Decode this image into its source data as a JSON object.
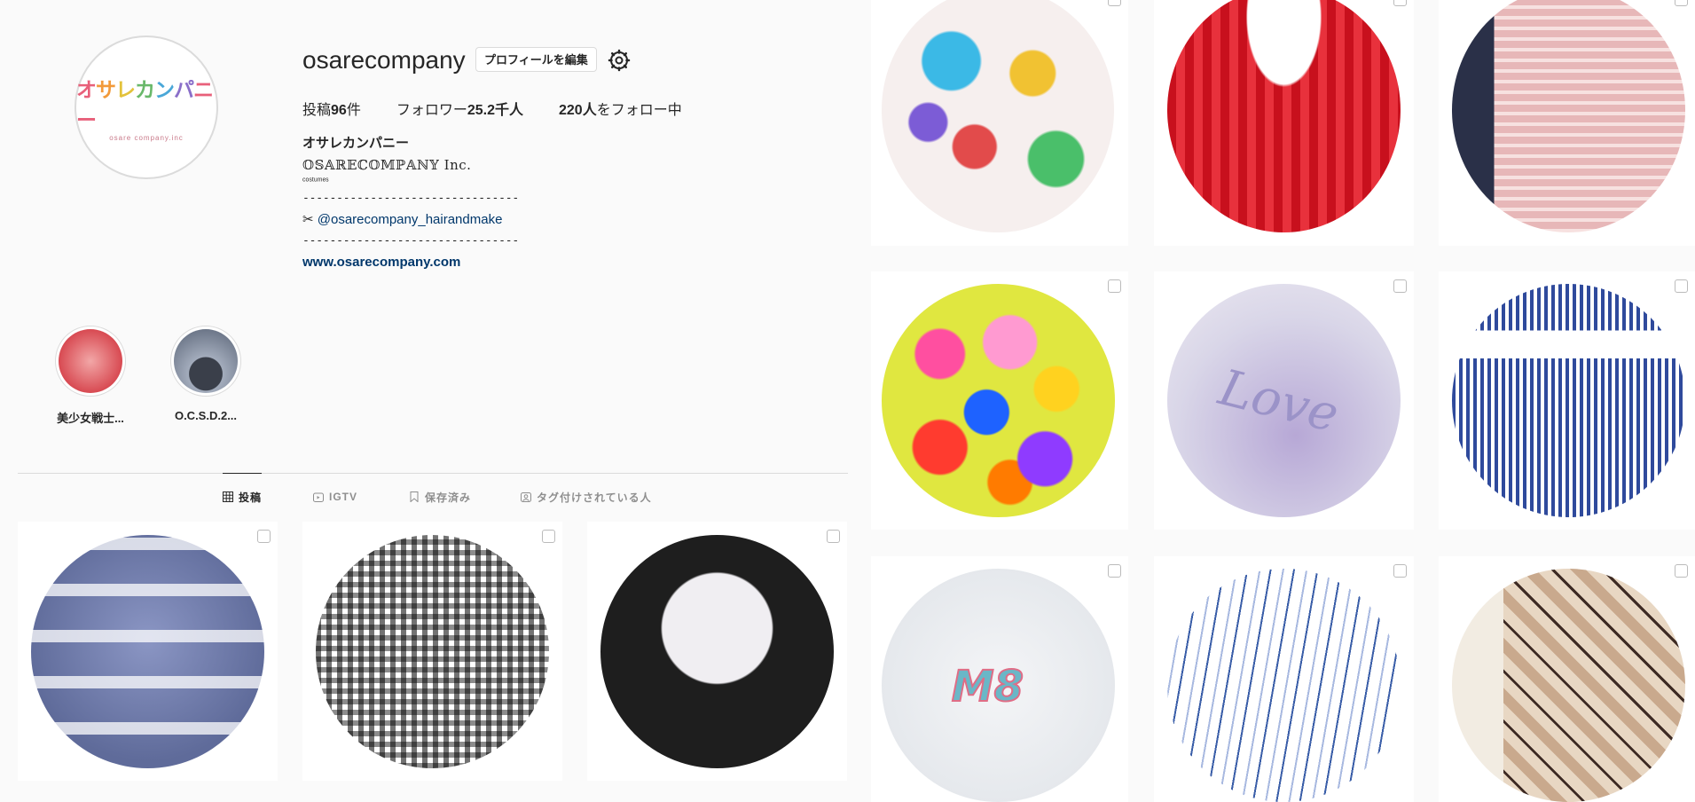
{
  "profile": {
    "username": "osarecompany",
    "edit_button": "プロフィールを編集",
    "avatar_logo": "オサレカンパニー",
    "avatar_logo_sub": "osare company.inc",
    "stats": {
      "posts_label": "投稿",
      "posts_value": "96",
      "posts_unit": "件",
      "followers_label": "フォロワー",
      "followers_value": "25.2千人",
      "following_value": "220人",
      "following_label": "をフォロー中"
    },
    "bio": {
      "name": "オサレカンパニー",
      "line1": "𝕆𝕊𝔸ℝ𝔼ℂ𝕆𝕄ℙ𝔸ℕ𝕐 Inc.",
      "line2": "ᶜᵒˢᵗᵘᵐᵉˢ",
      "dash1": "--------------------------------",
      "link_prefix": "✂︎ ",
      "link": "@osarecompany_hairandmake",
      "dash2": "--------------------------------",
      "url": "www.osarecompany.com"
    }
  },
  "highlights": [
    {
      "label": "美少女戦士..."
    },
    {
      "label": "O.C.S.D.2..."
    }
  ],
  "tabs": [
    {
      "label": "投稿",
      "icon": "grid-icon"
    },
    {
      "label": "IGTV",
      "icon": "igtv-icon"
    },
    {
      "label": "保存済み",
      "icon": "bookmark-icon"
    },
    {
      "label": "タグ付けされている人",
      "icon": "tag-person-icon"
    }
  ],
  "posts_left": [
    {
      "subject": "lace-blue-skirt"
    },
    {
      "subject": "gingham-dot-dress"
    },
    {
      "subject": "black-mesh-jacket"
    }
  ],
  "posts_right": [
    {
      "subject": "painted-letters"
    },
    {
      "subject": "red-tutu"
    },
    {
      "subject": "pink-pleats"
    },
    {
      "subject": "flowers"
    },
    {
      "subject": "love-embroidery"
    },
    {
      "subject": "check-ruffle"
    },
    {
      "subject": "m8-pocket"
    },
    {
      "subject": "blue-floral-stripe"
    },
    {
      "subject": "plaid-belt"
    }
  ]
}
